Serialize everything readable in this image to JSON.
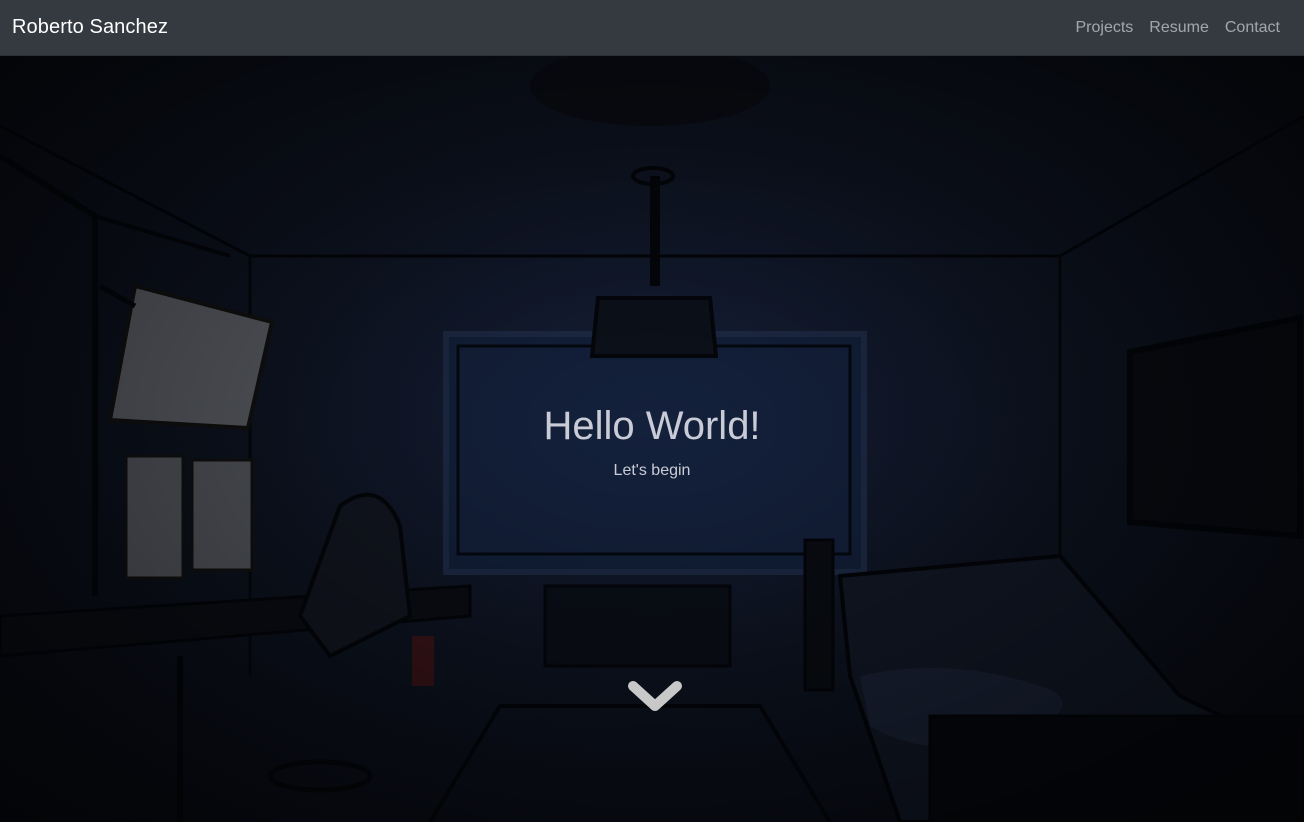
{
  "navbar": {
    "brand": "Roberto Sanchez",
    "links": [
      {
        "label": "Projects"
      },
      {
        "label": "Resume"
      },
      {
        "label": "Contact"
      }
    ]
  },
  "hero": {
    "title": "Hello World!",
    "subtitle": "Let's begin",
    "scroll_icon": "chevron-down-icon"
  },
  "colors": {
    "navbar_bg": "#343a40",
    "brand_text": "#ffffff",
    "nav_link_text": "#a0a3a7",
    "hero_text": "#c9ccd6",
    "chevron": "#c8c8c8"
  }
}
